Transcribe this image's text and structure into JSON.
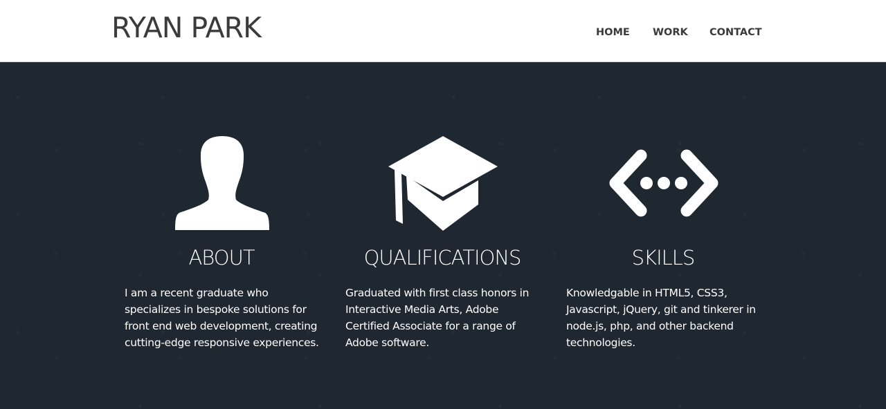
{
  "header": {
    "logo": "RYAN PARK",
    "nav": [
      {
        "label": "HOME"
      },
      {
        "label": "WORK"
      },
      {
        "label": "CONTACT"
      }
    ]
  },
  "sections": [
    {
      "icon": "user-silhouette-icon",
      "title": "ABOUT",
      "text": "I am a recent graduate who specializes in bespoke solutions for front end web development, creating cutting-edge responsive experiences."
    },
    {
      "icon": "graduation-cap-icon",
      "title": "QUALIFICATIONS",
      "text": "Graduated with first class honors in Interactive Media Arts, Adobe Certified Associate for a range of Adobe software."
    },
    {
      "icon": "code-brackets-icon",
      "title": "SKILLS",
      "text": "Knowledgable in HTML5, CSS3, Javascript, jQuery, git and tinkerer in node.js, php, and other backend technologies."
    }
  ],
  "colors": {
    "header_bg": "#ffffff",
    "page_bg": "#1f2731",
    "text_light": "#ffffff",
    "text_dark": "#3a3a3a"
  }
}
